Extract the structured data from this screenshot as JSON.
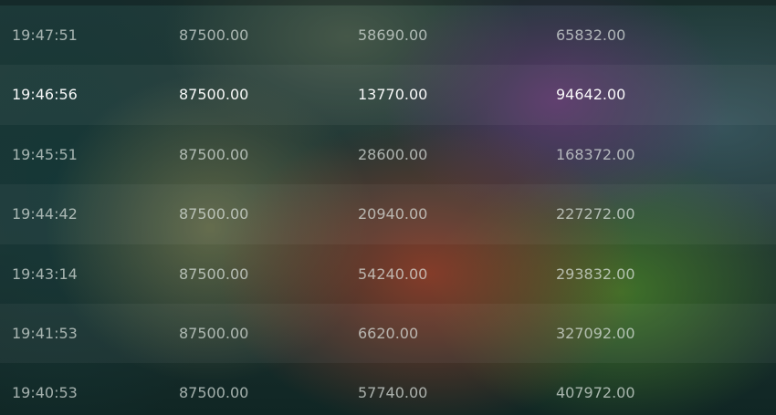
{
  "table": {
    "rows": [
      {
        "time": "19:47:51",
        "col1": "87500.00",
        "col2": "58690.00",
        "col3": "65832.00"
      },
      {
        "time": "19:46:56",
        "col1": "87500.00",
        "col2": "13770.00",
        "col3": "94642.00"
      },
      {
        "time": "19:45:51",
        "col1": "87500.00",
        "col2": "28600.00",
        "col3": "168372.00"
      },
      {
        "time": "19:44:42",
        "col1": "87500.00",
        "col2": "20940.00",
        "col3": "227272.00"
      },
      {
        "time": "19:43:14",
        "col1": "87500.00",
        "col2": "54240.00",
        "col3": "293832.00"
      },
      {
        "time": "19:41:53",
        "col1": "87500.00",
        "col2": "6620.00",
        "col3": "327092.00"
      },
      {
        "time": "19:40:53",
        "col1": "87500.00",
        "col2": "57740.00",
        "col3": "407972.00"
      }
    ]
  }
}
